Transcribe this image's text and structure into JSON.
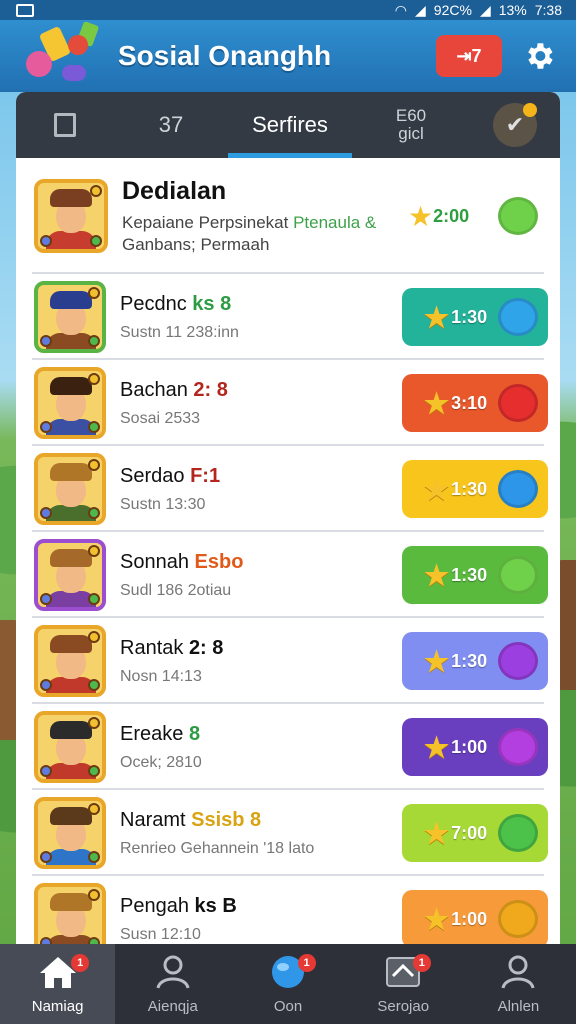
{
  "status_bar": {
    "wifi": "wifi-icon",
    "battery_pct": "92C%",
    "signal": "13%",
    "time": "7:38"
  },
  "header": {
    "title": "Sosial Onanghh",
    "badge_label": "⇥7",
    "settings_icon": "gear-icon"
  },
  "tabs": [
    {
      "label": "",
      "icon": "book-icon"
    },
    {
      "label": "37"
    },
    {
      "label": "Serfires",
      "active": true
    },
    {
      "label_line1": "E60",
      "label_line2": "gicl"
    },
    {
      "label": "",
      "icon": "check-badge-icon"
    }
  ],
  "rows": [
    {
      "name": "Dedialan",
      "sub_line1": "Kepaiane Perpsinekat",
      "sub_hl": "Ptenaula &",
      "sub_line2": "Ganbans; Permaah",
      "value": "2:00",
      "pill_color": "",
      "heart_color": "#6fd04a",
      "avatar_hat": "#7a3f20",
      "avatar_body": "#c63c2e",
      "frame": "#e9a72a"
    },
    {
      "name": "Pecdnc",
      "tag": "ks 8",
      "tag_color": "#2e9b44",
      "sub": "Sustn 11 238:inn",
      "value": "1:30",
      "pill_color": "#22b39a",
      "heart_color": "#2fa4e8",
      "avatar_hat": "#2a3e8f",
      "avatar_body": "#8a4a22",
      "frame": "#59b443"
    },
    {
      "name": "Bachan",
      "tag": "2: 8",
      "tag_color": "#b3261e",
      "sub": "Sosai 2533",
      "value": "3:10",
      "pill_color": "#e9582b",
      "heart_color": "#e62e2e",
      "avatar_hat": "#3b2210",
      "avatar_body": "#3b4fa3",
      "frame": "#e9a72a"
    },
    {
      "name": "Serdao",
      "tag": "F:1",
      "tag_color": "#b3261e",
      "sub": "Sustn 13:30",
      "value": "1:30",
      "pill_color": "#f7c51c",
      "heart_color": "#2e96e8",
      "avatar_hat": "#b07628",
      "avatar_body": "#4a6f2c",
      "frame": "#e9a72a"
    },
    {
      "name": "Sonnah",
      "tag": "Esbo",
      "tag_color": "#e05a1a",
      "sub": "Sudl 186 2otiau",
      "value": "1:30",
      "pill_color": "#59ba3e",
      "heart_color": "#6fd04a",
      "avatar_hat": "#a56a2a",
      "avatar_body": "#7a3fa1",
      "frame": "#9b4fd0"
    },
    {
      "name": "Rantak",
      "tag": "2: 8",
      "tag_color": "#111111",
      "sub": "Nosn 14:13",
      "value": "1:30",
      "pill_color": "#7f8ef0",
      "heart_color": "#9b3fe0",
      "avatar_hat": "#8a4a22",
      "avatar_body": "#c0392b",
      "frame": "#e9a72a"
    },
    {
      "name": "Ereake",
      "tag": "8",
      "tag_color": "#2e9b44",
      "sub": "Ocek; 2810",
      "value": "1:00",
      "pill_color": "#6a3fbf",
      "heart_color": "#b33fe0",
      "avatar_hat": "#2b2b2b",
      "avatar_body": "#c0392b",
      "frame": "#e9a72a"
    },
    {
      "name": "Naramt",
      "tag": "Ssisb 8",
      "tag_color": "#d9a411",
      "sub": "Renrieo Gehannein '18 lato",
      "value": "7:00",
      "pill_color": "#a6d936",
      "heart_color": "#4cc24a",
      "avatar_hat": "#5a3a1a",
      "avatar_body": "#2e74c9",
      "frame": "#e9a72a"
    },
    {
      "name": "Pengah",
      "tag": "ks B",
      "tag_color": "#111111",
      "sub": "Susn 12:10",
      "value": "1:00",
      "pill_color": "#f79a3a",
      "heart_color": "#f0a81c",
      "avatar_hat": "#b07628",
      "avatar_body": "#8a4a22",
      "frame": "#e9a72a"
    }
  ],
  "nav": [
    {
      "label": "Namiag",
      "icon": "home-icon",
      "badge": "1",
      "active": true
    },
    {
      "label": "Aienqja",
      "icon": "people-icon",
      "badge": ""
    },
    {
      "label": "Oon",
      "icon": "globe-icon",
      "badge": "1"
    },
    {
      "label": "Serojao",
      "icon": "inbox-icon",
      "badge": "1"
    },
    {
      "label": "Alnlen",
      "icon": "profile-icon",
      "badge": ""
    }
  ]
}
